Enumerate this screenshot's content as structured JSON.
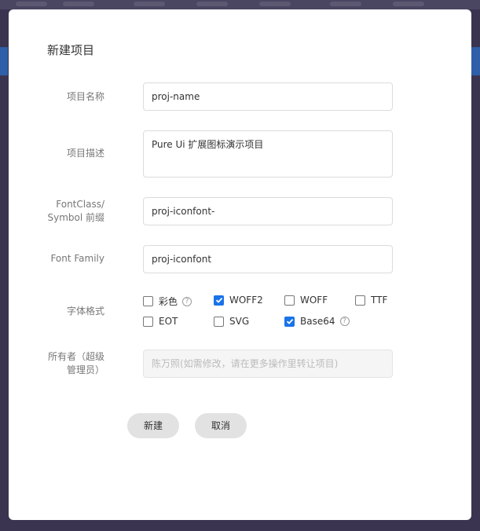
{
  "dialog": {
    "title": "新建项目",
    "fields": {
      "name": {
        "label": "项目名称",
        "value": "proj-name"
      },
      "desc": {
        "label": "项目描述",
        "value": "Pure Ui 扩展图标演示项目"
      },
      "prefix": {
        "label_line1": "FontClass/",
        "label_line2": "Symbol 前缀",
        "value": "proj-iconfont-"
      },
      "family": {
        "label": "Font Family",
        "value": "proj-iconfont"
      },
      "formats": {
        "label": "字体格式",
        "options": [
          {
            "label": "彩色",
            "checked": false,
            "help": true
          },
          {
            "label": "WOFF2",
            "checked": true,
            "help": false
          },
          {
            "label": "WOFF",
            "checked": false,
            "help": false
          },
          {
            "label": "TTF",
            "checked": false,
            "help": false
          },
          {
            "label": "EOT",
            "checked": false,
            "help": false
          },
          {
            "label": "SVG",
            "checked": false,
            "help": false
          },
          {
            "label": "Base64",
            "checked": true,
            "help": true
          }
        ],
        "help_glyph": "?"
      },
      "owner": {
        "label_line1": "所有者（超级",
        "label_line2": "管理员）",
        "value": "陈万照(如需修改，请在更多操作里转让项目)"
      }
    },
    "buttons": {
      "create": "新建",
      "cancel": "取消"
    }
  },
  "colors": {
    "accent": "#1a73e8",
    "button_bg": "#e2e2e2",
    "backdrop": "#3a3450"
  }
}
